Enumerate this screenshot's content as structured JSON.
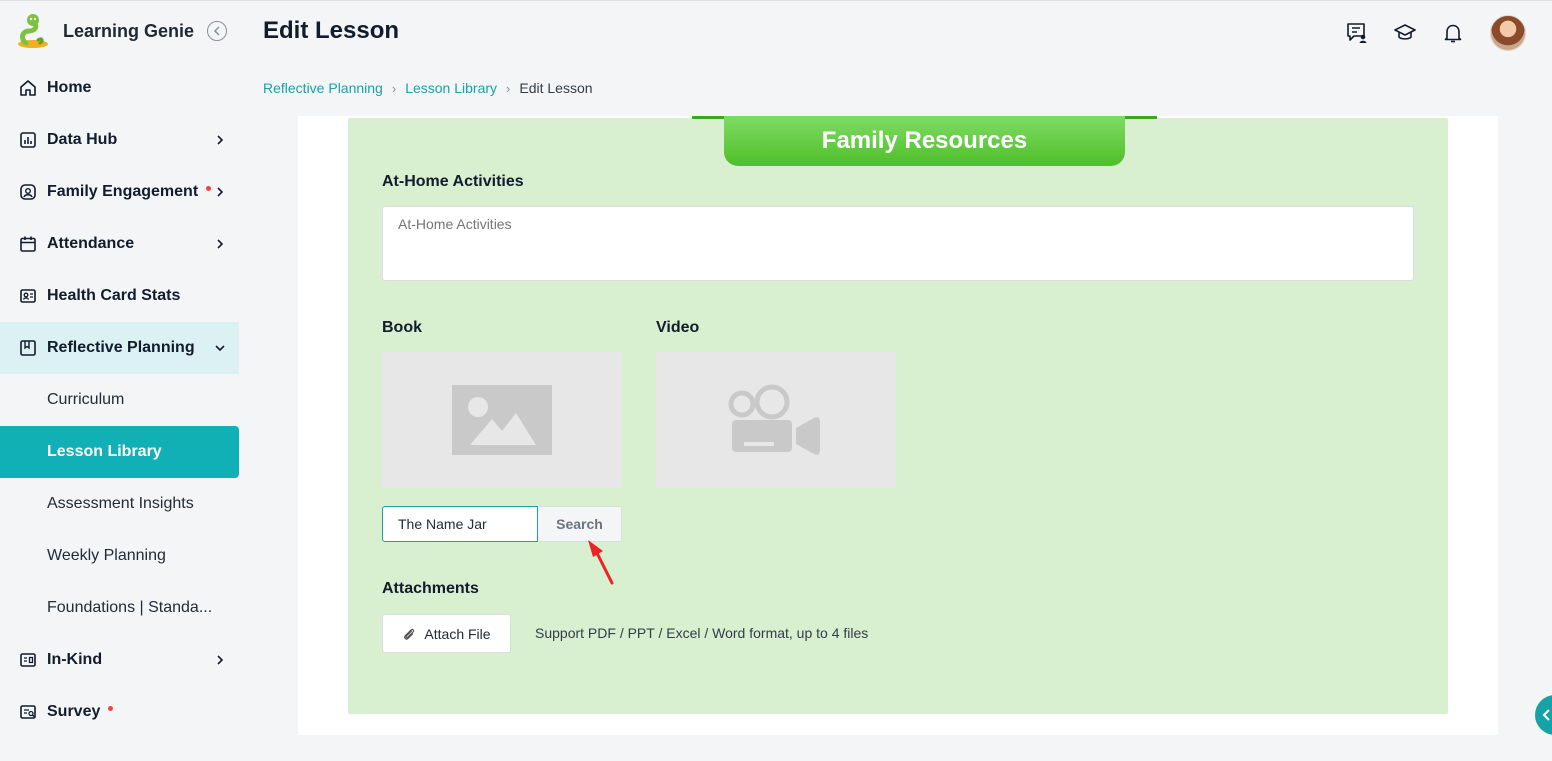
{
  "brand": {
    "name": "Learning Genie"
  },
  "header": {
    "title": "Edit Lesson",
    "breadcrumb": [
      "Reflective Planning",
      "Lesson Library",
      "Edit Lesson"
    ]
  },
  "sidebar": {
    "items": [
      {
        "label": "Home",
        "icon": "home-icon"
      },
      {
        "label": "Data Hub",
        "icon": "bar-chart-icon"
      },
      {
        "label": "Family Engagement",
        "icon": "family-icon"
      },
      {
        "label": "Attendance",
        "icon": "calendar-icon"
      },
      {
        "label": "Health Card Stats",
        "icon": "health-card-icon"
      },
      {
        "label": "Reflective Planning",
        "icon": "bookmark-icon"
      },
      {
        "label": "In-Kind",
        "icon": "in-kind-icon"
      },
      {
        "label": "Survey",
        "icon": "survey-icon"
      }
    ],
    "sub_items": [
      "Curriculum",
      "Lesson Library",
      "Assessment Insights",
      "Weekly Planning",
      "Foundations | Standa..."
    ],
    "active_sub_item": "Lesson Library"
  },
  "section": {
    "title": "Family Resources",
    "at_home_label": "At-Home Activities",
    "at_home_placeholder": "At-Home Activities",
    "book_label": "Book",
    "video_label": "Video",
    "book_search_value": "The Name Jar",
    "search_label": "Search",
    "attachments_label": "Attachments",
    "attach_button_label": "Attach File",
    "attach_hint": "Support PDF / PPT / Excel / Word format, up to 4 files"
  },
  "colors": {
    "accent": "#10b0b6",
    "ribbon": "#4fbf2a",
    "panel": "#d8efd0",
    "alert_dot": "#ef4444"
  }
}
